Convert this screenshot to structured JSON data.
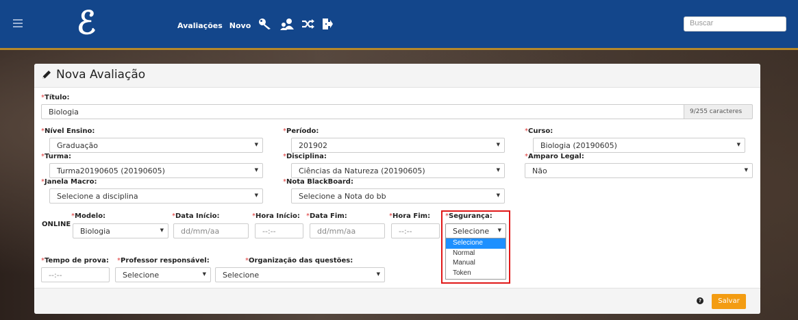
{
  "navbar": {
    "logo": "ℰ",
    "links": [
      "Avaliações",
      "Novo"
    ],
    "icons": [
      "key-user-icon",
      "users-icon",
      "shuffle-icon",
      "sign-out-icon"
    ],
    "search_placeholder": "Buscar"
  },
  "card": {
    "title": "Nova Avaliação"
  },
  "form": {
    "titulo": {
      "label": "Título:",
      "value": "Biologia",
      "counter": "9/255 caracteres"
    },
    "nivel_ensino": {
      "label": "Nível Ensino:",
      "value": "Graduação"
    },
    "periodo": {
      "label": "Período:",
      "value": "201902"
    },
    "curso": {
      "label": "Curso:",
      "value": "Biologia (20190605)"
    },
    "turma": {
      "label": "Turma:",
      "value": "Turma20190605 (20190605)"
    },
    "disciplina": {
      "label": "Disciplina:",
      "value": "Ciências da Natureza (20190605)"
    },
    "amparo_legal": {
      "label": "Amparo Legal:",
      "value": "Não"
    },
    "janela_macro": {
      "label": "Janela Macro:",
      "value": "Selecione a disciplina"
    },
    "nota_blackboard": {
      "label": "Nota BlackBoard:",
      "value": "Selecione a Nota do bb"
    },
    "online_label": "ONLINE",
    "modelo": {
      "label": "Modelo:",
      "value": "Biologia"
    },
    "data_inicio": {
      "label": "Data Início:",
      "placeholder": "dd/mm/aa"
    },
    "hora_inicio": {
      "label": "Hora Início:",
      "placeholder": "--:--"
    },
    "data_fim": {
      "label": "Data Fim:",
      "placeholder": "dd/mm/aa"
    },
    "hora_fim": {
      "label": "Hora Fim:",
      "placeholder": "--:--"
    },
    "seguranca": {
      "label": "Segurança:",
      "value": "Selecione",
      "options": [
        "Selecione",
        "Normal",
        "Manual",
        "Token"
      ],
      "highlighted": "Selecione"
    },
    "tempo_prova": {
      "label": "Tempo de prova:",
      "placeholder": "--:--"
    },
    "professor": {
      "label": "Professor responsável:",
      "value": "Selecione"
    },
    "organizacao": {
      "label": "Organização das questões:",
      "value": "Selecione"
    }
  },
  "footer": {
    "help_icon": "question-circle-icon",
    "save_label": "Salvar"
  },
  "colors": {
    "navbar": "#13468b",
    "navbar_border": "#b5882a",
    "save": "#f39c12",
    "highlight_box": "#e01717",
    "option_selected": "#1e90ff"
  }
}
